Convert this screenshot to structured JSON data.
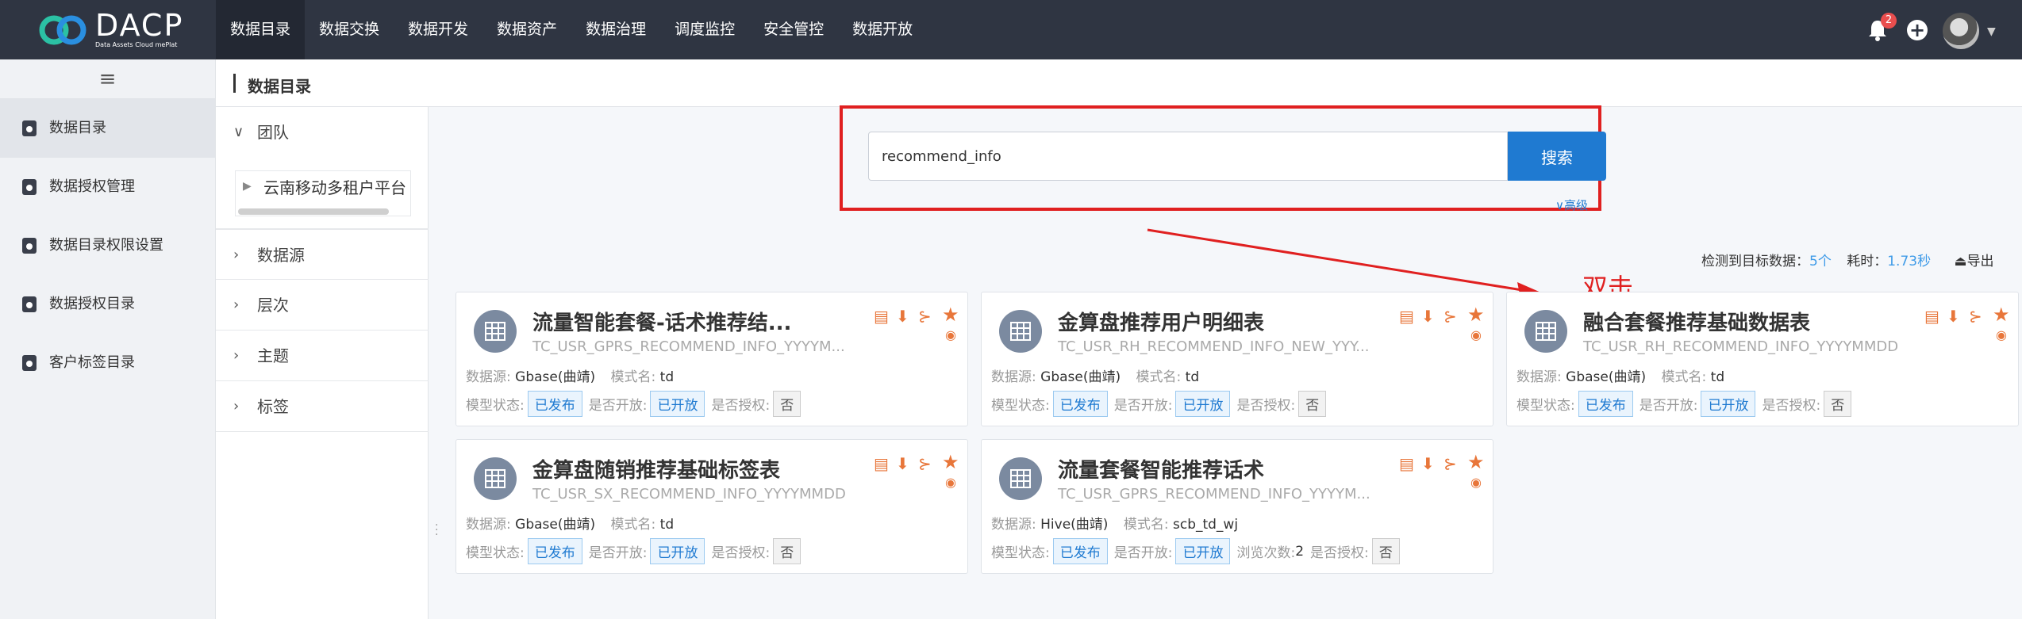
{
  "brand": {
    "name": "DACP",
    "tagline": "Data Assets Cloud mePlat"
  },
  "nav": [
    "数据目录",
    "数据交换",
    "数据开发",
    "数据资产",
    "数据治理",
    "调度监控",
    "安全管控",
    "数据开放"
  ],
  "notifications": {
    "count": "2"
  },
  "sidebar": {
    "toggle": "≡",
    "items": [
      "数据目录",
      "数据授权管理",
      "数据目录权限设置",
      "数据授权目录",
      "客户标签目录"
    ]
  },
  "breadcrumb": "数据目录",
  "filters": {
    "team": {
      "label": "团队",
      "node": "云南移动多租户平台"
    },
    "groups": [
      "数据源",
      "层次",
      "主题",
      "标签"
    ]
  },
  "search": {
    "value": "recommend_info",
    "button": "搜索",
    "advanced": "∨高级"
  },
  "result": {
    "label": "检测到目标数据：",
    "count": "5个",
    "time_label": "耗时：",
    "time": "1.73秒",
    "export": "导出"
  },
  "annotation": {
    "text": "双击"
  },
  "labels": {
    "source": "数据源:",
    "schema": "模式名:",
    "status": "模型状态:",
    "open": "是否开放:",
    "auth": "是否授权:",
    "views": "浏览次数:"
  },
  "cards": [
    {
      "title": "流量智能套餐-话术推荐结...",
      "code": "TC_USR_GPRS_RECOMMEND_INFO_YYYYM...",
      "source": "Gbase(曲靖)",
      "schema": "td",
      "status": "已发布",
      "open": "已开放",
      "auth": "否"
    },
    {
      "title": "金算盘推荐用户明细表",
      "code": "TC_USR_RH_RECOMMEND_INFO_NEW_YYY...",
      "source": "Gbase(曲靖)",
      "schema": "td",
      "status": "已发布",
      "open": "已开放",
      "auth": "否"
    },
    {
      "title": "融合套餐推荐基础数据表",
      "code": "TC_USR_RH_RECOMMEND_INFO_YYYYMMDD",
      "source": "Gbase(曲靖)",
      "schema": "td",
      "status": "已发布",
      "open": "已开放",
      "auth": "否"
    },
    {
      "title": "金算盘随销推荐基础标签表",
      "code": "TC_USR_SX_RECOMMEND_INFO_YYYYMMDD",
      "source": "Gbase(曲靖)",
      "schema": "td",
      "status": "已发布",
      "open": "已开放",
      "auth": "否"
    },
    {
      "title": "流量套餐智能推荐话术",
      "code": "TC_USR_GPRS_RECOMMEND_INFO_YYYYM...",
      "source": "Hive(曲靖)",
      "schema": "scb_td_wj",
      "status": "已发布",
      "open": "已开放",
      "views": "2",
      "auth": "否"
    }
  ]
}
